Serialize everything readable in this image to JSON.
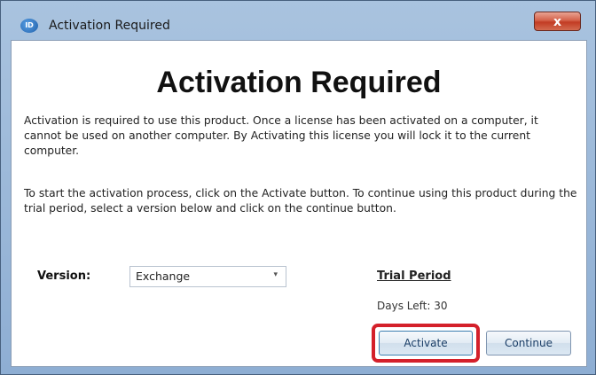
{
  "window": {
    "title": "Activation Required",
    "close_label": "x"
  },
  "content": {
    "heading": "Activation Required",
    "paragraph1": "Activation is required to use this product.  Once a license has been activated on a computer, it cannot be used on another computer.  By Activating this license you will lock it to the current computer.",
    "paragraph2": "To start the activation process, click on the Activate button.  To continue using this product during the trial period, select a version below and click on the continue button."
  },
  "version": {
    "label": "Version:",
    "selected": "Exchange"
  },
  "trial": {
    "title": "Trial Period",
    "days_label": "Days Left:",
    "days_value": "30"
  },
  "buttons": {
    "activate": "Activate",
    "continue": "Continue"
  },
  "colors": {
    "highlight": "#d4202a",
    "title_bar": "#a9c3df"
  },
  "icons": {
    "app": "app-logo-icon",
    "close": "close-icon",
    "dropdown": "chevron-down-icon"
  }
}
